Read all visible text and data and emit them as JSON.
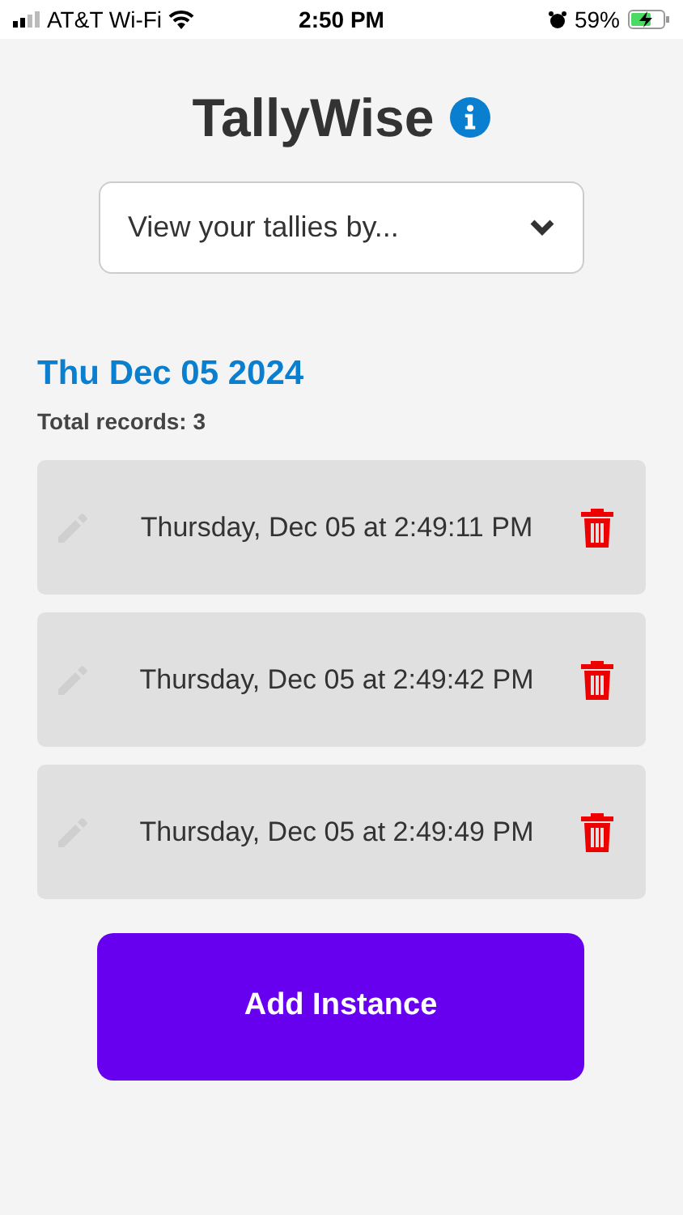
{
  "status_bar": {
    "carrier": "AT&T Wi-Fi",
    "time": "2:50 PM",
    "battery": "59%"
  },
  "app": {
    "title": "TallyWise"
  },
  "view_dropdown": {
    "placeholder": "View your tallies by..."
  },
  "date_heading": "Thu Dec 05 2024",
  "total_records": "Total records: 3",
  "records": [
    {
      "timestamp": "Thursday, Dec 05 at 2:49:11 PM"
    },
    {
      "timestamp": "Thursday, Dec 05 at 2:49:42 PM"
    },
    {
      "timestamp": "Thursday, Dec 05 at 2:49:49 PM"
    }
  ],
  "add_button": "Add Instance"
}
